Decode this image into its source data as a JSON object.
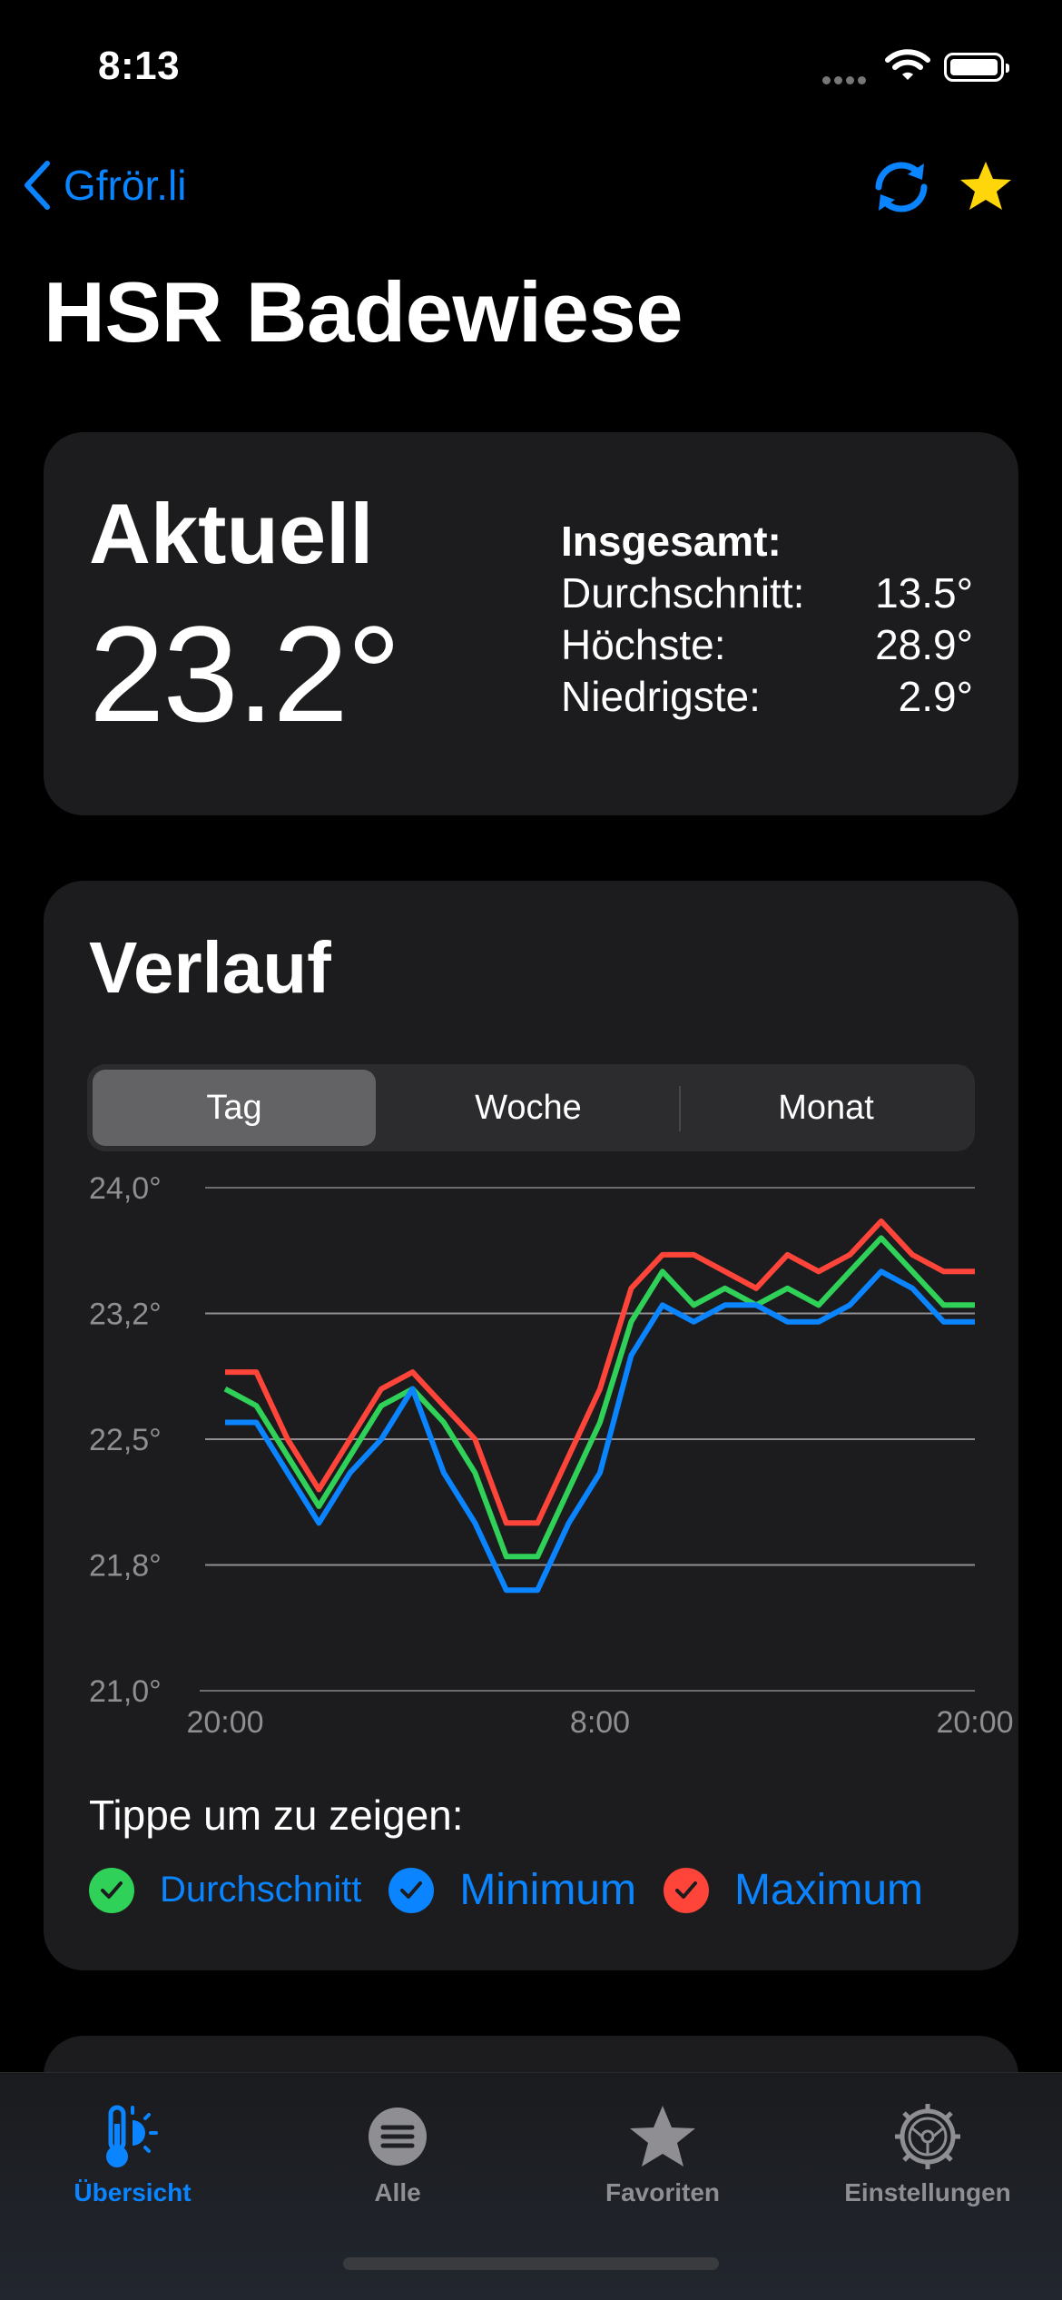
{
  "status_bar": {
    "time": "8:13"
  },
  "nav": {
    "back_label": "Gfrör.li",
    "refresh_icon": "refresh-icon",
    "favorite_icon": "star-icon",
    "star_color": "#ffd60a",
    "accent": "#0a84ff"
  },
  "title": "HSR Badewiese",
  "current": {
    "label": "Aktuell",
    "value": "23.2°",
    "stats_title": "Insgesamt:",
    "stats": [
      {
        "label": "Durchschnitt:",
        "value": "13.5°"
      },
      {
        "label": "Höchste:",
        "value": "28.9°"
      },
      {
        "label": "Niedrigste:",
        "value": "2.9°"
      }
    ]
  },
  "history": {
    "title": "Verlauf",
    "segments": [
      "Tag",
      "Woche",
      "Monat"
    ],
    "selected_segment": "Tag",
    "tap_hint": "Tippe um zu zeigen:",
    "legend": [
      {
        "label": "Durchschnitt",
        "color": "#30d158",
        "checked": true
      },
      {
        "label": "Minimum",
        "color": "#0a84ff",
        "checked": true
      },
      {
        "label": "Maximum",
        "color": "#ff453a",
        "checked": true
      }
    ]
  },
  "chart_data": {
    "type": "line",
    "y_tick_labels": [
      "24,0°",
      "23,2°",
      "22,5°",
      "21,8°",
      "21,0°"
    ],
    "y_ticks": [
      24.0,
      23.25,
      22.5,
      21.75,
      21.0
    ],
    "ylim": [
      21.0,
      24.0
    ],
    "x_tick_labels": [
      "20:00",
      "8:00",
      "20:00"
    ],
    "x_ticks": [
      0,
      12,
      24
    ],
    "grid": true,
    "x": [
      0,
      1,
      2,
      3,
      4,
      5,
      6,
      7,
      8,
      9,
      10,
      11,
      12,
      13,
      14,
      15,
      16,
      17,
      18,
      19,
      20,
      21,
      22,
      23,
      24
    ],
    "series": [
      {
        "name": "Maximum",
        "color": "#ff453a",
        "values": [
          22.9,
          22.9,
          22.5,
          22.2,
          22.5,
          22.8,
          22.9,
          22.7,
          22.5,
          22.0,
          22.0,
          22.4,
          22.8,
          23.4,
          23.6,
          23.6,
          23.5,
          23.4,
          23.6,
          23.5,
          23.6,
          23.8,
          23.6,
          23.5,
          23.5
        ]
      },
      {
        "name": "Durchschnitt",
        "color": "#30d158",
        "values": [
          22.8,
          22.7,
          22.4,
          22.1,
          22.4,
          22.7,
          22.8,
          22.6,
          22.3,
          21.8,
          21.8,
          22.2,
          22.6,
          23.2,
          23.5,
          23.3,
          23.4,
          23.3,
          23.4,
          23.3,
          23.5,
          23.7,
          23.5,
          23.3,
          23.3
        ]
      },
      {
        "name": "Minimum",
        "color": "#0a84ff",
        "values": [
          22.6,
          22.6,
          22.3,
          22.0,
          22.3,
          22.5,
          22.8,
          22.3,
          22.0,
          21.6,
          21.6,
          22.0,
          22.3,
          23.0,
          23.3,
          23.2,
          23.3,
          23.3,
          23.2,
          23.2,
          23.3,
          23.5,
          23.4,
          23.2,
          23.2
        ]
      }
    ]
  },
  "tabbar": {
    "items": [
      {
        "label": "Übersicht",
        "icon": "thermometer-sun-icon",
        "active": true
      },
      {
        "label": "Alle",
        "icon": "list-icon",
        "active": false
      },
      {
        "label": "Favoriten",
        "icon": "star-icon",
        "active": false
      },
      {
        "label": "Einstellungen",
        "icon": "gear-icon",
        "active": false
      }
    ]
  }
}
